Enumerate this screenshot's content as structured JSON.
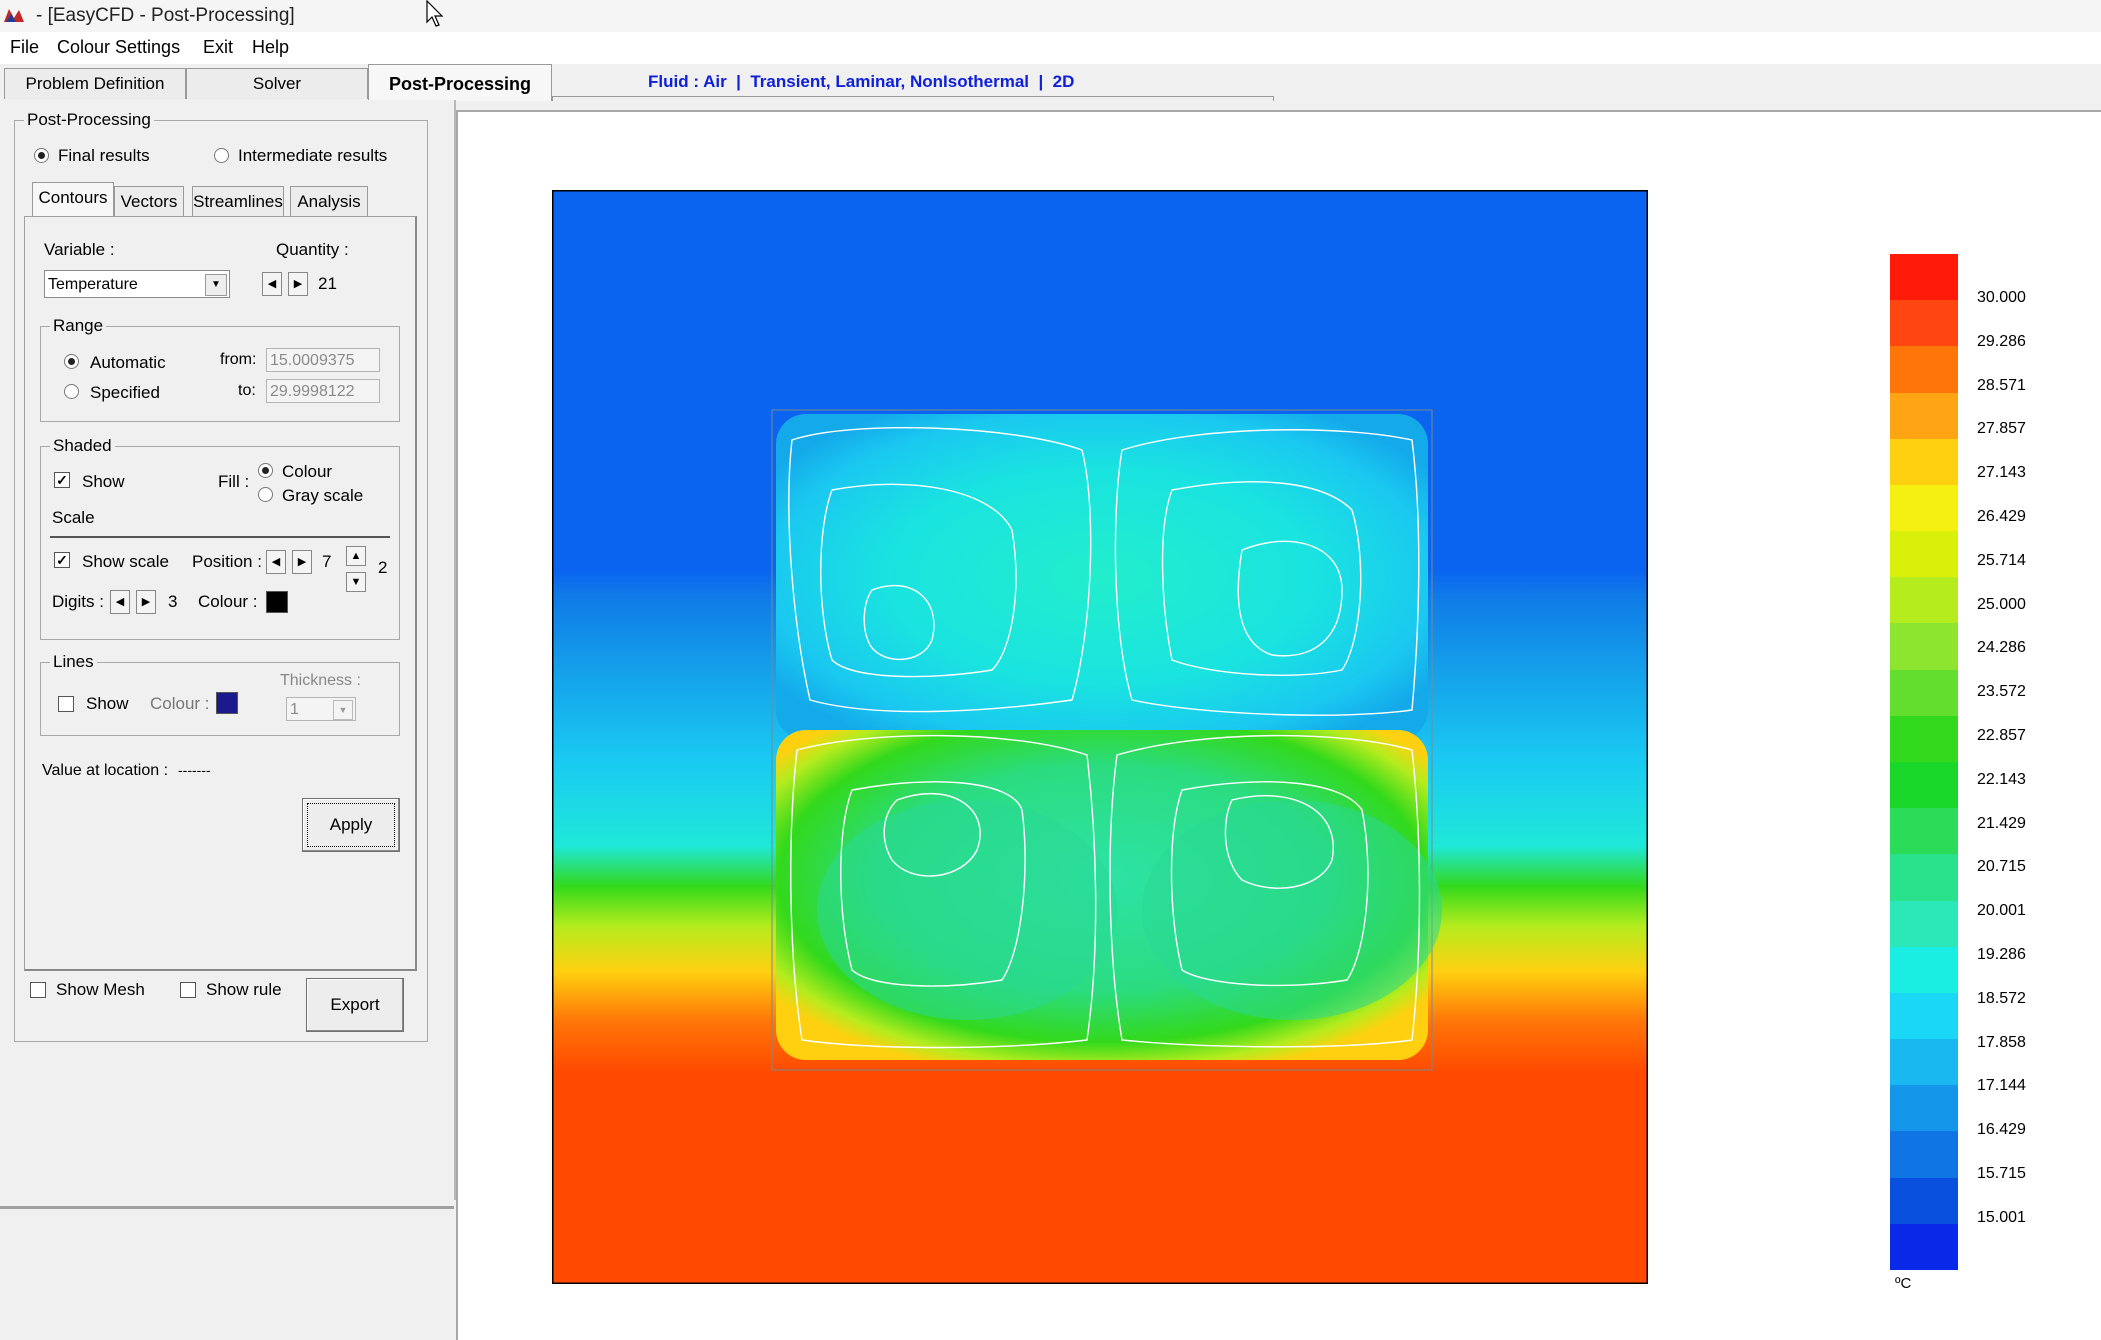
{
  "window": {
    "title": "- [EasyCFD - Post-Processing]"
  },
  "menu": {
    "items": [
      "File",
      "Colour Settings",
      "Exit",
      "Help"
    ]
  },
  "tabs": {
    "items": [
      "Problem Definition",
      "Solver",
      "Post-Processing"
    ],
    "active": "Post-Processing"
  },
  "fluid_info": "Fluid : Air  |  Transient, Laminar, NonIsothermal  |  2D",
  "post": {
    "group_title": "Post-Processing",
    "final_results": "Final results",
    "intermediate_results": "Intermediate results",
    "mode": "final",
    "subtabs": [
      "Contours",
      "Vectors",
      "Streamlines",
      "Analysis"
    ],
    "variable_label": "Variable :",
    "variable_value": "Temperature",
    "quantity_label": "Quantity :",
    "quantity_value": "21",
    "range": {
      "title": "Range",
      "automatic": "Automatic",
      "specified": "Specified",
      "mode": "automatic",
      "from_label": "from:",
      "from_value": "15.0009375",
      "to_label": "to:",
      "to_value": "29.9998122"
    },
    "shaded": {
      "title": "Shaded",
      "show": "Show",
      "show_checked": true,
      "fill_label": "Fill :",
      "colour": "Colour",
      "gray_scale": "Gray scale",
      "fill_mode": "colour",
      "scale_title": "Scale",
      "show_scale": "Show scale",
      "show_scale_checked": true,
      "position_label": "Position :",
      "position_value": "7",
      "position_sub_value": "2",
      "digits_label": "Digits :",
      "digits_value": "3",
      "colour_label": "Colour :",
      "scale_colour": "#000000"
    },
    "lines": {
      "title": "Lines",
      "show": "Show",
      "show_checked": false,
      "colour_label": "Colour :",
      "line_colour": "#1a1a8c",
      "thickness_label": "Thickness :",
      "thickness_value": "1"
    },
    "value_at_location_label": "Value at location :",
    "value_at_location": "-------",
    "apply": "Apply",
    "show_mesh": "Show Mesh",
    "show_rule": "Show rule",
    "export": "Export"
  },
  "colorbar": {
    "ticks": [
      "30.000",
      "29.286",
      "28.571",
      "27.857",
      "27.143",
      "26.429",
      "25.714",
      "25.000",
      "24.286",
      "23.572",
      "22.857",
      "22.143",
      "21.429",
      "20.715",
      "20.001",
      "19.286",
      "18.572",
      "17.858",
      "17.144",
      "16.429",
      "15.715",
      "15.001"
    ],
    "colors": [
      "#ff1a0a",
      "#ff4510",
      "#ff7508",
      "#ffa514",
      "#ffd010",
      "#f5f010",
      "#d8f00a",
      "#b5ec1e",
      "#8ee530",
      "#62df2e",
      "#33d91c",
      "#19d82a",
      "#2bdc58",
      "#2be28c",
      "#2ce8b8",
      "#1aede2",
      "#1ad8f5",
      "#1ab8f0",
      "#1496ea",
      "#0f74e4",
      "#0a50df",
      "#0a28e8"
    ],
    "unit": "ºC"
  },
  "field": {
    "hot_color": "#ff4a00",
    "cold_color": "#0a64f0",
    "min_temperature": 15.0009375,
    "max_temperature": 29.9998122
  }
}
